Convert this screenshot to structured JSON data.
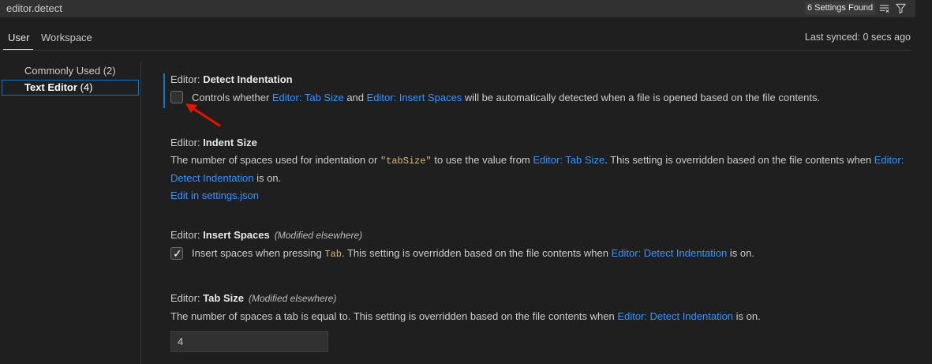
{
  "search": {
    "value": "editor.detect"
  },
  "results_badge": "6 Settings Found",
  "tabs": {
    "user": "User",
    "workspace": "Workspace"
  },
  "last_synced": "Last synced: 0 secs ago",
  "toc": {
    "commonly_used": {
      "label": "Commonly Used",
      "count": "(2)"
    },
    "text_editor": {
      "label": "Text Editor",
      "count": "(4)"
    }
  },
  "settings": {
    "detect_indentation": {
      "category": "Editor: ",
      "name": "Detect Indentation",
      "checked": false,
      "desc_1": "Controls whether ",
      "link_1": "Editor: Tab Size",
      "desc_2": " and ",
      "link_2": "Editor: Insert Spaces",
      "desc_3": " will be automatically detected when a file is opened based on the file contents."
    },
    "indent_size": {
      "category": "Editor: ",
      "name": "Indent Size",
      "desc_1": "The number of spaces used for indentation or ",
      "code": "\"tabSize\"",
      "desc_2": " to use the value from ",
      "link_1": "Editor: Tab Size",
      "desc_3": ". This setting is overridden based on the file contents when ",
      "link_2a": "Editor:",
      "link_2b": "Detect Indentation",
      "desc_4": " is on.",
      "edit_link": "Edit in settings.json"
    },
    "insert_spaces": {
      "category": "Editor: ",
      "name": "Insert Spaces",
      "modified": "(Modified elsewhere)",
      "checked": true,
      "desc_1": "Insert spaces when pressing ",
      "code": "Tab",
      "desc_2": ". This setting is overridden based on the file contents when ",
      "link_1": "Editor: Detect Indentation",
      "desc_3": " is on."
    },
    "tab_size": {
      "category": "Editor: ",
      "name": "Tab Size",
      "modified": "(Modified elsewhere)",
      "desc_1": "The number of spaces a tab is equal to. This setting is overridden based on the file contents when ",
      "link_1": "Editor: Detect Indentation",
      "desc_2": " is on.",
      "value": "4"
    }
  },
  "colors": {
    "accent": "#0078d4",
    "link": "#3794ff",
    "annotation_arrow": "#e51400"
  }
}
